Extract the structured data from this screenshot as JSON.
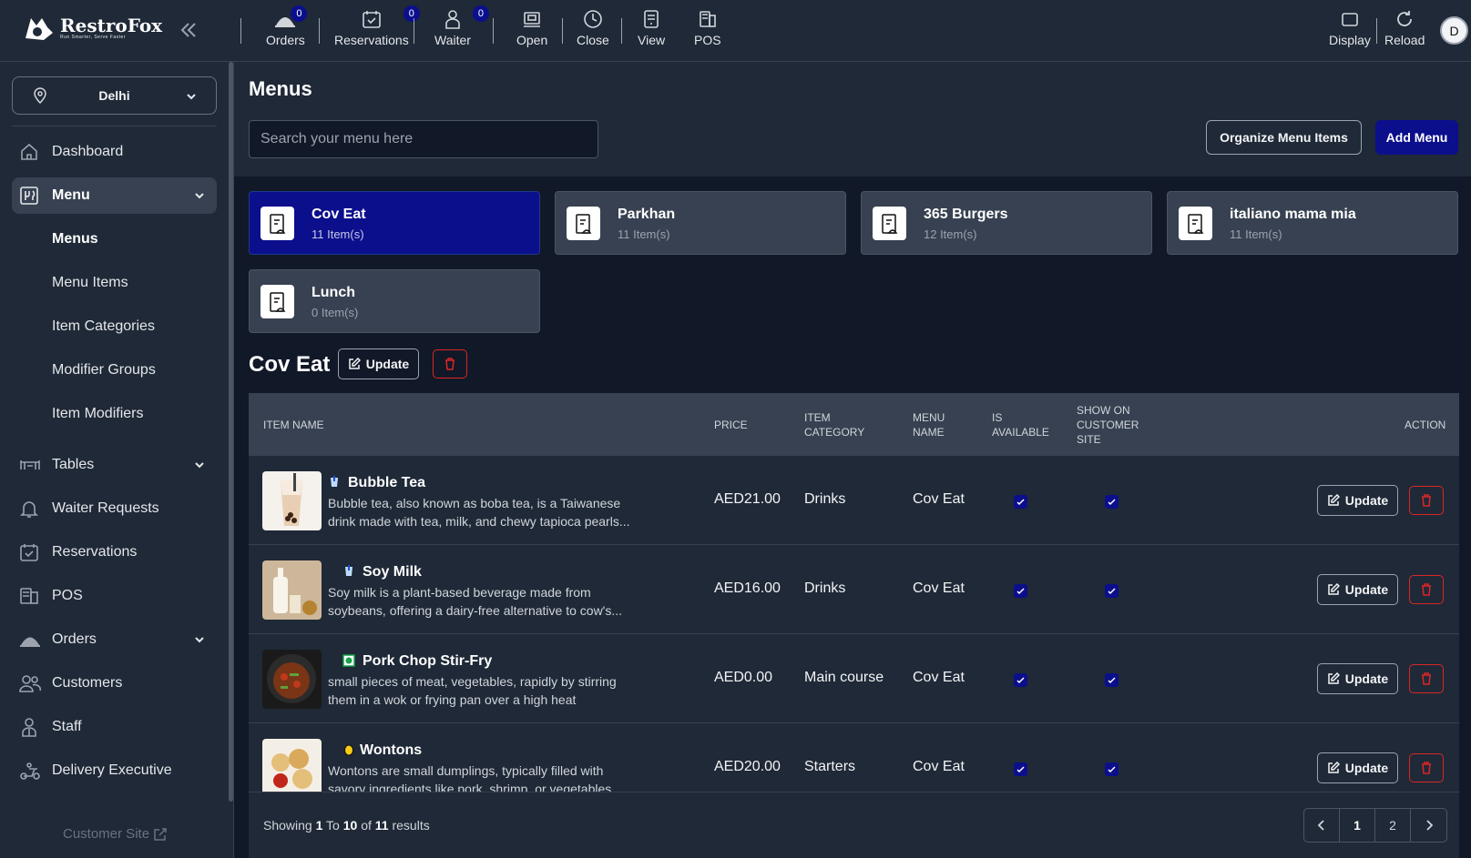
{
  "brand": {
    "name": "RestroFox",
    "tagline": "Run Smarter, Serve Faster"
  },
  "topbar": {
    "items": [
      {
        "label": "Orders",
        "badge": "0"
      },
      {
        "label": "Reservations",
        "badge": "0"
      },
      {
        "label": "Waiter",
        "badge": "0"
      },
      {
        "label": "Open"
      },
      {
        "label": "Close"
      },
      {
        "label": "View"
      },
      {
        "label": "POS"
      }
    ],
    "right": [
      {
        "label": "Display"
      },
      {
        "label": "Reload"
      }
    ],
    "avatar": "D"
  },
  "sidebar": {
    "location": "Delhi",
    "nav": [
      {
        "label": "Dashboard",
        "icon": "home-icon"
      },
      {
        "label": "Menu",
        "icon": "menu-book-icon",
        "active": true
      },
      {
        "label": "Tables",
        "icon": "table-icon"
      },
      {
        "label": "Waiter Requests",
        "icon": "bell-icon"
      },
      {
        "label": "Reservations",
        "icon": "calendar-check-icon"
      },
      {
        "label": "POS",
        "icon": "pos-icon"
      },
      {
        "label": "Orders",
        "icon": "cloche-icon"
      },
      {
        "label": "Customers",
        "icon": "users-icon"
      },
      {
        "label": "Staff",
        "icon": "staff-icon"
      },
      {
        "label": "Delivery Executive",
        "icon": "scooter-icon"
      }
    ],
    "menu_sub": [
      "Menus",
      "Menu Items",
      "Item Categories",
      "Modifier Groups",
      "Item Modifiers"
    ],
    "customer_site": "Customer Site"
  },
  "page": {
    "title": "Menus",
    "search_placeholder": "Search your menu here",
    "organize_label": "Organize Menu Items",
    "add_label": "Add Menu"
  },
  "menus": [
    {
      "name": "Cov Eat",
      "count": "11 Item(s)",
      "active": true
    },
    {
      "name": "Parkhan",
      "count": "11 Item(s)"
    },
    {
      "name": "365 Burgers",
      "count": "12 Item(s)"
    },
    {
      "name": "italiano mama mia",
      "count": "11 Item(s)"
    },
    {
      "name": "Lunch",
      "count": "0 Item(s)"
    }
  ],
  "selected": {
    "title": "Cov Eat",
    "update_label": "Update"
  },
  "table": {
    "headers": {
      "item_name": "ITEM NAME",
      "price": "PRICE",
      "category_1": "ITEM",
      "category_2": "CATEGORY",
      "menu_1": "MENU",
      "menu_2": "NAME",
      "avail_1": "IS",
      "avail_2": "AVAILABLE",
      "show_1": "SHOW ON",
      "show_2": "CUSTOMER",
      "show_3": "SITE",
      "action": "ACTION"
    },
    "rows": [
      {
        "name": "Bubble Tea",
        "type": "drink",
        "desc1": "Bubble tea, also known as boba tea, is a Taiwanese",
        "desc2": "drink made with tea, milk, and chewy tapioca pearls...",
        "price": "AED21.00",
        "category": "Drinks",
        "menu": "Cov Eat",
        "available": true,
        "show_site": true
      },
      {
        "name": "Soy Milk",
        "type": "drink",
        "desc1": "Soy milk is a plant-based beverage made from",
        "desc2": "soybeans, offering a dairy-free alternative to cow's...",
        "price": "AED16.00",
        "category": "Drinks",
        "menu": "Cov Eat",
        "available": true,
        "show_site": true
      },
      {
        "name": "Pork Chop Stir-Fry",
        "type": "veg",
        "desc1": "small pieces of meat, vegetables, rapidly by stirring",
        "desc2": "them in a wok or frying pan over a high heat",
        "price": "AED0.00",
        "category": "Main course",
        "menu": "Cov Eat",
        "available": true,
        "show_site": true
      },
      {
        "name": "Wontons",
        "type": "egg",
        "desc1": "Wontons are small dumplings, typically filled with",
        "desc2": "savory ingredients like pork, shrimp, or vegetables,...",
        "price": "AED20.00",
        "category": "Starters",
        "menu": "Cov Eat",
        "available": true,
        "show_site": true
      }
    ],
    "update_label": "Update",
    "footer": {
      "pre": "Showing",
      "from": "1",
      "to_word": "To",
      "to": "10",
      "of_word": "of",
      "total": "11",
      "post": "results"
    },
    "pages": [
      "1",
      "2"
    ]
  },
  "colors": {
    "accent": "#0b0f8c",
    "danger": "#dc2626",
    "bg": "#111827",
    "panel": "#1f2937"
  }
}
